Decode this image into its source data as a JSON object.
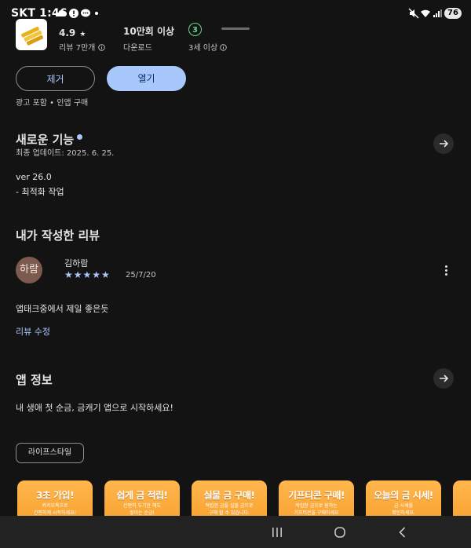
{
  "status_bar": {
    "carrier": "SKT",
    "time": "1:46",
    "battery": "76"
  },
  "app": {
    "rating": "4.9",
    "rating_star": "★",
    "reviews_label": "리뷰 7만개",
    "downloads": "10만회 이상",
    "downloads_label": "다운로드",
    "age_rating": "3",
    "age_label": "3세 이상"
  },
  "actions": {
    "remove": "제거",
    "open": "열기"
  },
  "ad_note": "광고 포함 • 인앱 구매",
  "whats_new": {
    "title": "새로운 기능",
    "updated": "최종 업데이트: 2025. 6. 25.",
    "version": "ver 26.0",
    "notes": "- 최적화 작업"
  },
  "my_review": {
    "title": "내가 작성한 리뷰",
    "avatar_text": "하람",
    "author": "김하람",
    "stars": "★★★★★",
    "date": "25/7/20",
    "text": "앱태크중에서 제일 좋은듯",
    "edit_label": "리뷰 수정"
  },
  "app_info": {
    "title": "앱 정보",
    "description": "내 생애 첫 순금, 금캐기 앱으로 시작하세요!",
    "category": "라이프스타일"
  },
  "screenshots": [
    {
      "title": "3초 가입!",
      "caption": "카카오톡으로\n간편하게 시작하세요!"
    },
    {
      "title": "쉽게 금 적립!",
      "caption": "간편히 두기만 해도\n쌓이는 순금!"
    },
    {
      "title": "실물 금 구매!",
      "caption": "적립한 금을 실물 금으로\n구매 할 수 있습니다."
    },
    {
      "title": "기프티콘 구매!",
      "caption": "적립한 금으로 원하는\n기프티콘을 구매하세요"
    },
    {
      "title": "오늘의 금 시세!",
      "caption": "금 시세를\n확인하세요."
    }
  ],
  "icons": {
    "status_left": [
      "cloud-icon",
      "alert-icon",
      "chat-icon",
      "dot-icon"
    ],
    "status_right": [
      "mute-icon",
      "wifi-icon",
      "signal-icon",
      "battery-icon"
    ],
    "nav": [
      "recents-icon",
      "home-icon",
      "back-icon"
    ]
  },
  "colors": {
    "accent": "#a8c7fa",
    "age_green": "#6dd58c",
    "screenshot_orange": "#f7a12e"
  }
}
